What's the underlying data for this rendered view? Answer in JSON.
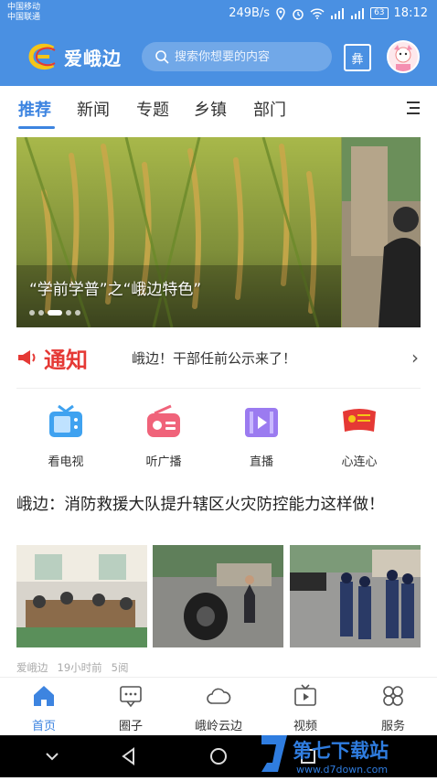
{
  "status_bar": {
    "carrier_1": "中国移动",
    "carrier_2": "中国联通",
    "net_speed": "249B/s",
    "battery": "63",
    "time": "18:12"
  },
  "app_bar": {
    "logo_text": "爱峨边",
    "search_placeholder": "搜索你想要的内容",
    "square_button_glyph": "彝"
  },
  "tabs": [
    "推荐",
    "新闻",
    "专题",
    "乡镇",
    "部门"
  ],
  "banner": {
    "caption": "“学前学普”之“峨边特色”",
    "slide_count": 5,
    "active_slide": 2
  },
  "notice": {
    "label": "通知",
    "text": "峨边！干部任前公示来了！"
  },
  "quick_links": [
    {
      "label": "看电视",
      "icon": "tv-icon",
      "color": "#3fa2f0"
    },
    {
      "label": "听广播",
      "icon": "radio-icon",
      "color": "#f0637a"
    },
    {
      "label": "直播",
      "icon": "live-icon",
      "color": "#9b7bf0"
    },
    {
      "label": "心连心",
      "icon": "party-flag-icon",
      "color": "#e53935"
    }
  ],
  "article": {
    "title": "峨边：消防救援大队提升辖区火灾防控能力这样做！",
    "source": "爱峨边",
    "time": "19小时前",
    "views": "5阅"
  },
  "bottom_nav": [
    {
      "label": "首页",
      "icon": "home-icon",
      "active": true
    },
    {
      "label": "圈子",
      "icon": "chat-icon",
      "active": false
    },
    {
      "label": "峨岭云边",
      "icon": "cloud-icon",
      "active": false
    },
    {
      "label": "视频",
      "icon": "video-icon",
      "active": false
    },
    {
      "label": "服务",
      "icon": "clover-icon",
      "active": false
    }
  ],
  "watermark": {
    "text": "第七下载站",
    "url": "www.d7down.com"
  },
  "colors": {
    "brand_blue": "#4a90e2",
    "accent_blue": "#3d84e0",
    "notice_red": "#e53935"
  }
}
